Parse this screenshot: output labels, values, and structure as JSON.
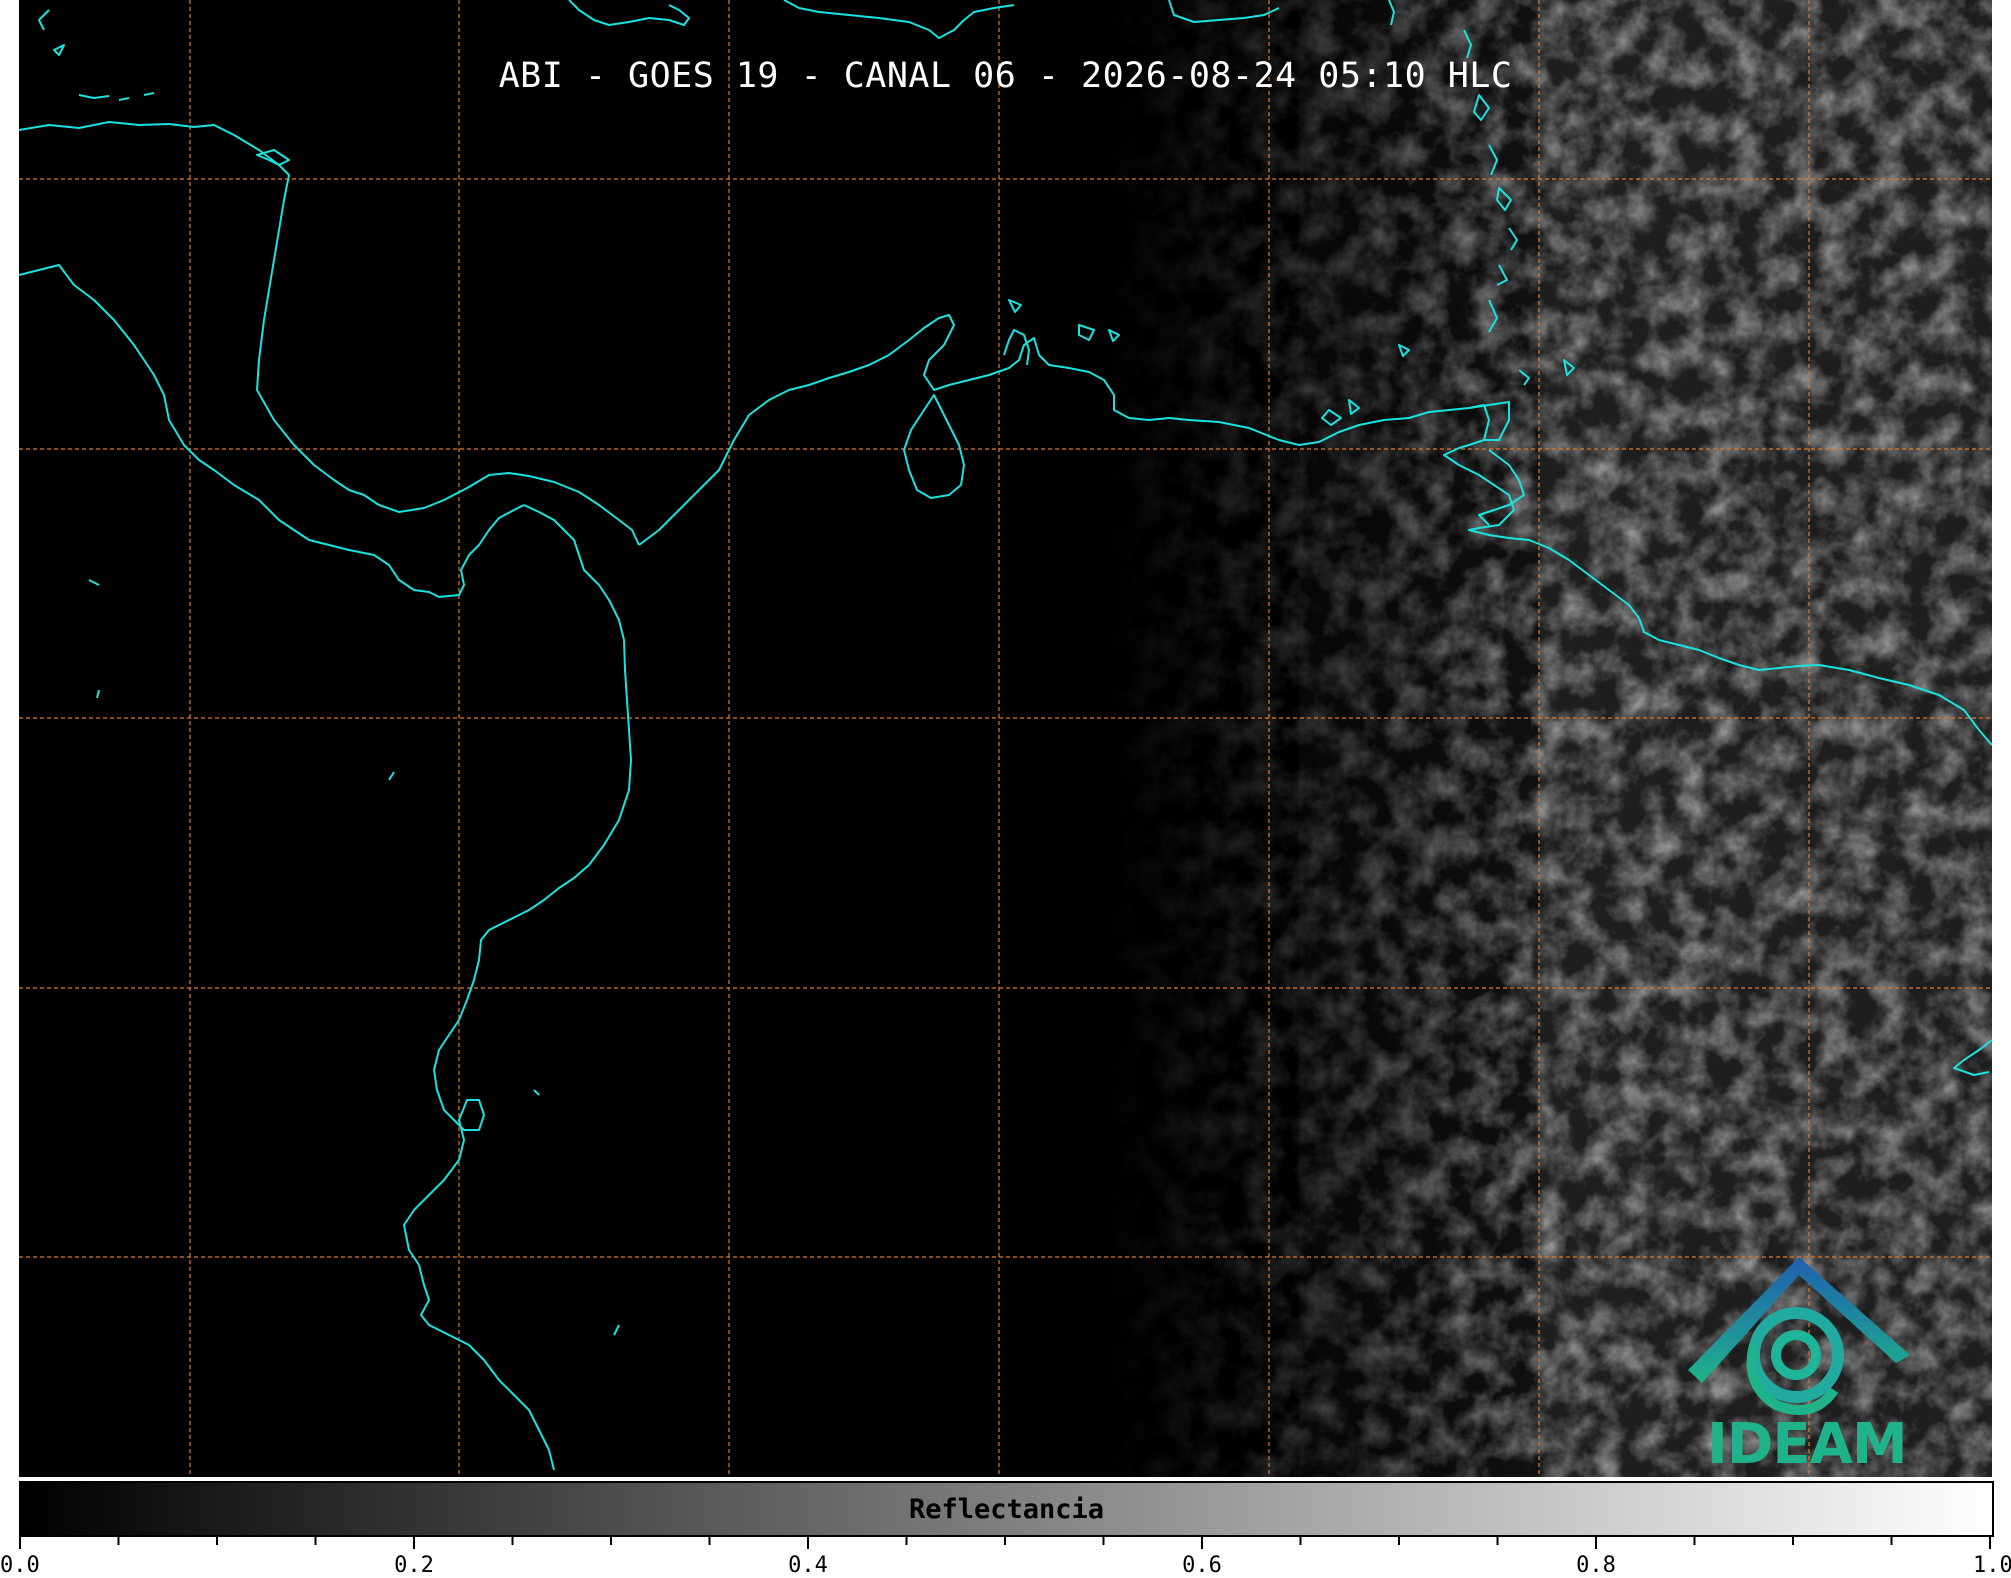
{
  "map": {
    "title": "ABI - GOES 19 - CANAL 06 - 2026-08-24 05:10 HLC",
    "coastline_color": "#19e3e0",
    "grid_color": "#e07a2a",
    "background": "#000000"
  },
  "logo": {
    "text": "IDEAM",
    "icon": "ideam-logo-icon",
    "colors": [
      "#1f6fb2",
      "#20b38b"
    ]
  },
  "colorbar": {
    "label": "Reflectancia",
    "range": [
      0.0,
      1.0
    ],
    "tick_labels": [
      "0.0",
      "0.2",
      "0.4",
      "0.6",
      "0.8",
      "1.0"
    ],
    "cmap_from": "#000000",
    "cmap_to": "#ffffff"
  }
}
